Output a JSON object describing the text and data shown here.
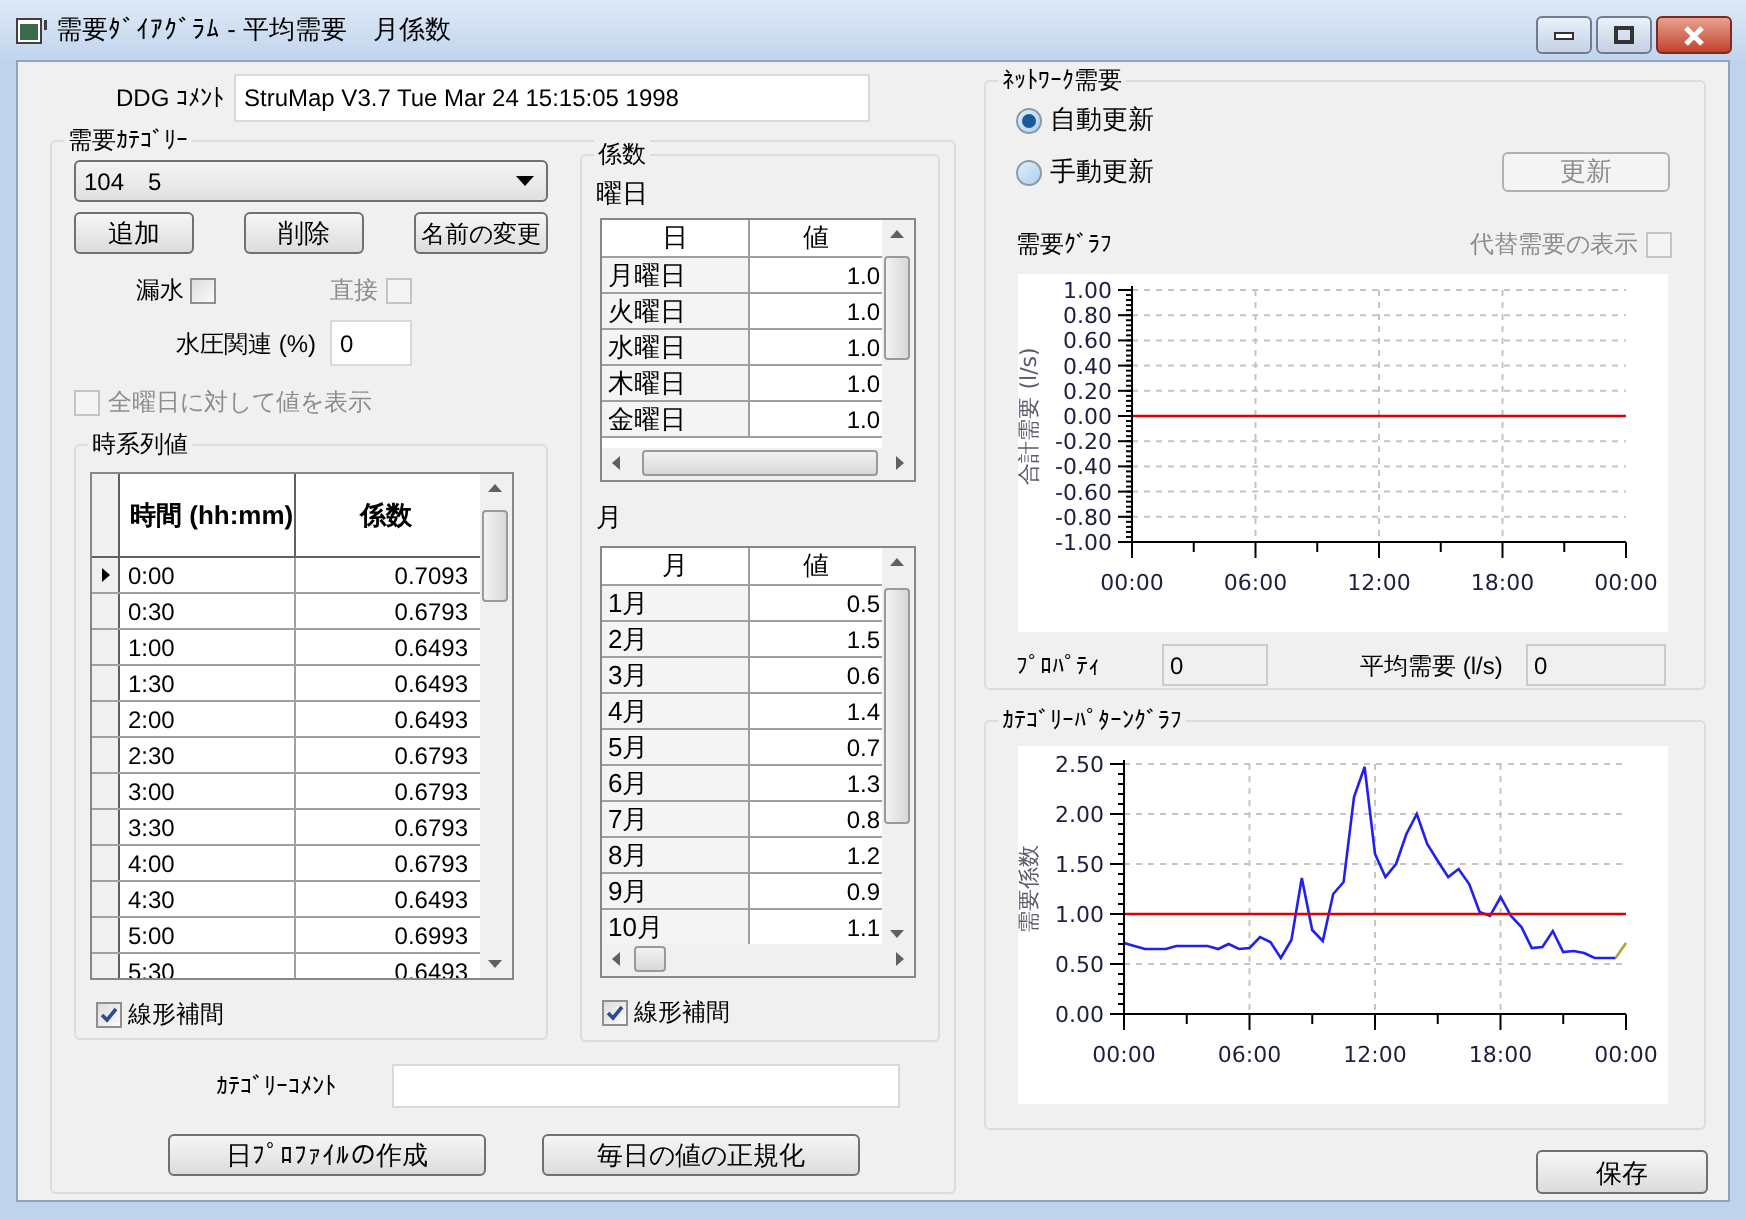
{
  "window": {
    "title": "需要ﾀﾞｲｱｸﾞﾗﾑ - 平均需要　月係数"
  },
  "ddg_comment": {
    "label": "DDG ｺﾒﾝﾄ",
    "value": "StruMap V3.7 Tue Mar 24 15:15:05 1998"
  },
  "demand_category": {
    "title": "需要ｶﾃｺﾞﾘｰ",
    "dropdown": {
      "value": "104　5"
    },
    "buttons": [
      "追加",
      "削除",
      "名前の変更"
    ],
    "leak": {
      "label": "漏水",
      "checked": false,
      "disabled": false
    },
    "direct": {
      "label": "直接",
      "checked": false,
      "disabled": true
    },
    "pressure": {
      "label": "水圧関連 (%)",
      "value": "0"
    },
    "all_days": {
      "label": "全曜日に対して値を表示",
      "checked": false,
      "disabled": true
    },
    "time_series": {
      "title": "時系列値",
      "columns": [
        "時間 (hh:mm)",
        "係数"
      ],
      "rows": [
        {
          "time": "0:00",
          "value": "0.7093",
          "selected": true
        },
        {
          "time": "0:30",
          "value": "0.6793",
          "selected": false
        },
        {
          "time": "1:00",
          "value": "0.6493",
          "selected": false
        },
        {
          "time": "1:30",
          "value": "0.6493",
          "selected": false
        },
        {
          "time": "2:00",
          "value": "0.6493",
          "selected": false
        },
        {
          "time": "2:30",
          "value": "0.6793",
          "selected": false
        },
        {
          "time": "3:00",
          "value": "0.6793",
          "selected": false
        },
        {
          "time": "3:30",
          "value": "0.6793",
          "selected": false
        },
        {
          "time": "4:00",
          "value": "0.6793",
          "selected": false
        },
        {
          "time": "4:30",
          "value": "0.6493",
          "selected": false
        },
        {
          "time": "5:00",
          "value": "0.6993",
          "selected": false
        },
        {
          "time": "5:30",
          "value": "0.6493",
          "selected": false
        }
      ],
      "linear": {
        "label": "線形補間",
        "checked": true
      }
    },
    "coefficients": {
      "title": "係数",
      "weekday": {
        "label": "曜日",
        "columns": [
          "日",
          "値"
        ],
        "rows": [
          {
            "day": "月曜日",
            "value": "1.0"
          },
          {
            "day": "火曜日",
            "value": "1.0"
          },
          {
            "day": "水曜日",
            "value": "1.0"
          },
          {
            "day": "木曜日",
            "value": "1.0"
          },
          {
            "day": "金曜日",
            "value": "1.0"
          }
        ]
      },
      "month": {
        "label": "月",
        "columns": [
          "月",
          "値"
        ],
        "rows": [
          {
            "month": "1月",
            "value": "0.5"
          },
          {
            "month": "2月",
            "value": "1.5"
          },
          {
            "month": "3月",
            "value": "0.6"
          },
          {
            "month": "4月",
            "value": "1.4"
          },
          {
            "month": "5月",
            "value": "0.7"
          },
          {
            "month": "6月",
            "value": "1.3"
          },
          {
            "month": "7月",
            "value": "0.8"
          },
          {
            "month": "8月",
            "value": "1.2"
          },
          {
            "month": "9月",
            "value": "0.9"
          },
          {
            "month": "10月",
            "value": "1.1"
          }
        ]
      },
      "linear": {
        "label": "線形補間",
        "checked": true
      }
    },
    "category_comment": {
      "label": "ｶﾃｺﾞﾘｰｺﾒﾝﾄ"
    },
    "action_buttons": [
      "日ﾌﾟﾛﾌｧｲﾙの作成",
      "毎日の値の正規化"
    ]
  },
  "network_demand": {
    "title": "ﾈｯﾄﾜｰｸ需要",
    "radios": [
      {
        "label": "自動更新",
        "selected": true
      },
      {
        "label": "手動更新",
        "selected": false
      }
    ],
    "update_button": {
      "label": "更新",
      "disabled": true
    },
    "graph_label": "需要ｸﾞﾗﾌ",
    "alternate": {
      "label": "代替需要の表示",
      "checked": false,
      "disabled": true
    },
    "chart_data": {
      "type": "line",
      "grid": true,
      "ylabel": "合計需要 (l/s)",
      "x": [
        0,
        24
      ],
      "series": [
        {
          "color": "#e00000",
          "values": [
            0,
            0
          ]
        }
      ],
      "xlim": [
        0,
        24
      ],
      "ylim": [
        -1,
        1
      ],
      "xticks": [
        {
          "value": 0,
          "label": "00:00"
        },
        {
          "value": 6,
          "label": "06:00"
        },
        {
          "value": 12,
          "label": "12:00"
        },
        {
          "value": 18,
          "label": "18:00"
        },
        {
          "value": 24,
          "label": "00:00"
        }
      ],
      "yticks": [
        {
          "value": 1,
          "label": "1.00"
        },
        {
          "value": 0.8,
          "label": "0.80"
        },
        {
          "value": 0.6,
          "label": "0.60"
        },
        {
          "value": 0.4,
          "label": "0.40"
        },
        {
          "value": 0.2,
          "label": "0.20"
        },
        {
          "value": 0,
          "label": "0.00"
        },
        {
          "value": -0.2,
          "label": "-0.20"
        },
        {
          "value": -0.4,
          "label": "-0.40"
        },
        {
          "value": -0.6,
          "label": "-0.60"
        },
        {
          "value": -0.8,
          "label": "-0.80"
        },
        {
          "value": -1,
          "label": "-1.00"
        }
      ]
    },
    "property": {
      "label": "ﾌﾟﾛﾊﾟﾃｨ",
      "value": "0"
    },
    "average": {
      "label": "平均需要 (l/s)",
      "value": "0"
    }
  },
  "category_pattern": {
    "title": "ｶﾃｺﾞﾘｰﾊﾟﾀｰﾝｸﾞﾗﾌ",
    "chart_data": {
      "type": "line",
      "grid": true,
      "ylabel": "需要係数",
      "x": [
        0,
        0.5,
        1,
        1.5,
        2,
        2.5,
        3,
        3.5,
        4,
        4.5,
        5,
        5.5,
        6,
        6.5,
        7,
        7.5,
        8,
        8.5,
        9,
        9.5,
        10,
        10.5,
        11,
        11.5,
        12,
        12.5,
        13,
        13.5,
        14,
        14.5,
        15,
        15.5,
        16,
        16.5,
        17,
        17.5,
        18,
        18.5,
        19,
        19.5,
        20,
        20.5,
        21,
        21.5,
        22,
        22.5,
        23,
        23.5,
        24
      ],
      "series": [
        {
          "color": "#2020f0",
          "values": [
            0.71,
            0.68,
            0.65,
            0.65,
            0.65,
            0.68,
            0.68,
            0.68,
            0.68,
            0.65,
            0.7,
            0.65,
            0.66,
            0.77,
            0.72,
            0.56,
            0.74,
            1.36,
            0.84,
            0.73,
            1.2,
            1.32,
            2.17,
            2.47,
            1.6,
            1.37,
            1.5,
            1.8,
            2.0,
            1.7,
            1.53,
            1.37,
            1.45,
            1.3,
            1.02,
            0.98,
            1.17,
            0.98,
            0.87,
            0.66,
            0.67,
            0.83,
            0.62,
            0.63,
            0.61,
            0.56,
            0.56,
            0.56,
            null
          ]
        },
        {
          "color": "#e00000",
          "values": [
            1,
            1,
            1,
            1,
            1,
            1,
            1,
            1,
            1,
            1,
            1,
            1,
            1,
            1,
            1,
            1,
            1,
            1,
            1,
            1,
            1,
            1,
            1,
            1,
            1,
            1,
            1,
            1,
            1,
            1,
            1,
            1,
            1,
            1,
            1,
            1,
            1,
            1,
            1,
            1,
            1,
            1,
            1,
            1,
            1,
            1,
            1,
            1,
            1
          ]
        },
        {
          "color": "#b0a040",
          "values": [
            null,
            null,
            null,
            null,
            null,
            null,
            null,
            null,
            null,
            null,
            null,
            null,
            null,
            null,
            null,
            null,
            null,
            null,
            null,
            null,
            null,
            null,
            null,
            null,
            null,
            null,
            null,
            null,
            null,
            null,
            null,
            null,
            null,
            null,
            null,
            null,
            null,
            null,
            null,
            null,
            null,
            null,
            null,
            null,
            null,
            null,
            null,
            0.56,
            0.71
          ]
        }
      ],
      "xlim": [
        0,
        24
      ],
      "ylim": [
        0,
        2.5
      ],
      "xticks": [
        {
          "value": 0,
          "label": "00:00"
        },
        {
          "value": 6,
          "label": "06:00"
        },
        {
          "value": 12,
          "label": "12:00"
        },
        {
          "value": 18,
          "label": "18:00"
        },
        {
          "value": 24,
          "label": "00:00"
        }
      ],
      "yticks": [
        {
          "value": 2.5,
          "label": "2.50"
        },
        {
          "value": 2,
          "label": "2.00"
        },
        {
          "value": 1.5,
          "label": "1.50"
        },
        {
          "value": 1,
          "label": "1.00"
        },
        {
          "value": 0.5,
          "label": "0.50"
        },
        {
          "value": 0,
          "label": "0.00"
        }
      ]
    }
  },
  "save_button": {
    "label": "保存"
  }
}
